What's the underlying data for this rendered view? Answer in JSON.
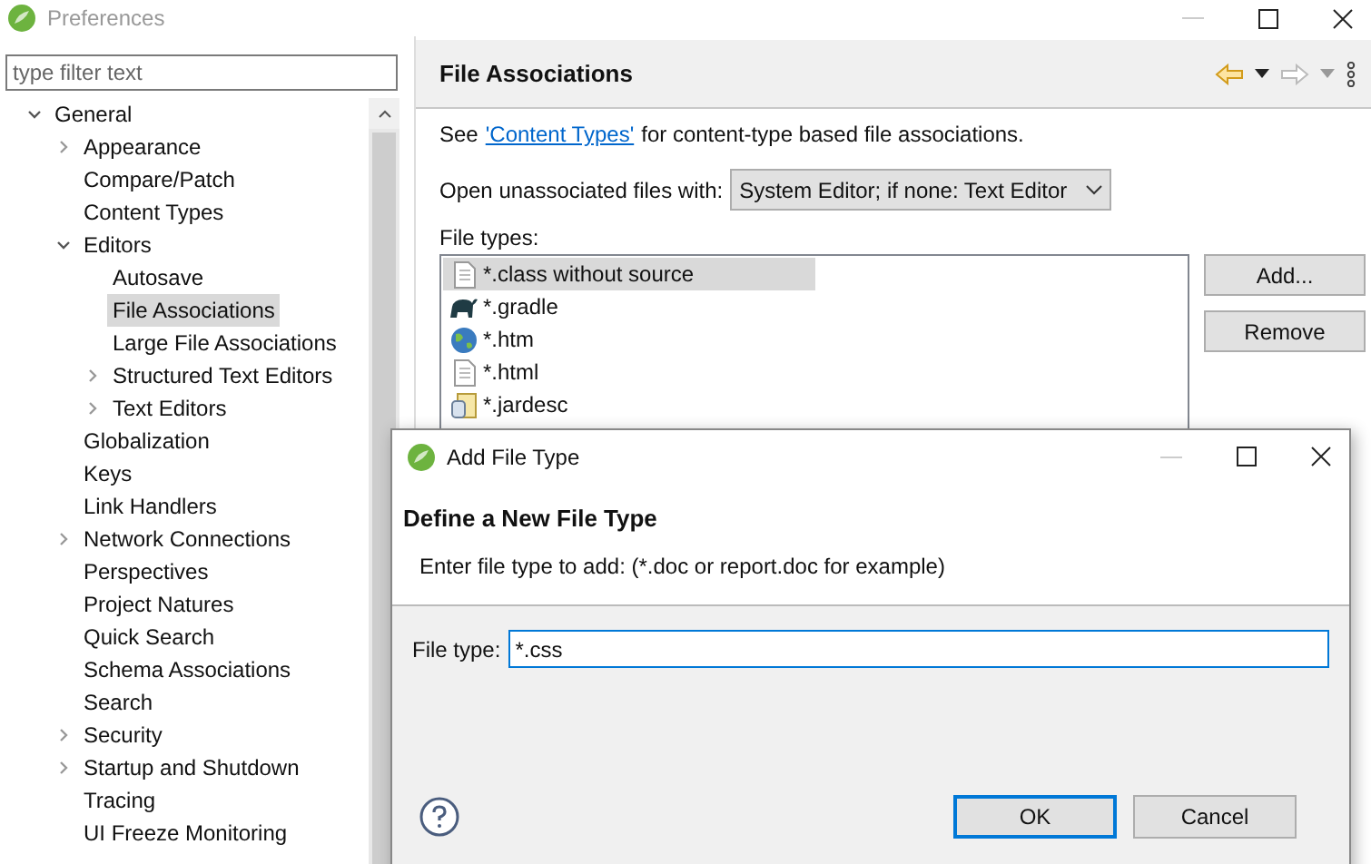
{
  "window": {
    "title": "Preferences"
  },
  "filter": {
    "placeholder": "type filter text"
  },
  "tree": [
    {
      "label": "General",
      "expanded": true,
      "selected": false,
      "children": [
        {
          "label": "Appearance",
          "expanded": false,
          "selected": false
        },
        {
          "label": "Compare/Patch",
          "selected": false
        },
        {
          "label": "Content Types",
          "selected": false
        },
        {
          "label": "Editors",
          "expanded": true,
          "selected": false,
          "children": [
            {
              "label": "Autosave",
              "selected": false
            },
            {
              "label": "File Associations",
              "selected": true
            },
            {
              "label": "Large File Associations",
              "selected": false
            },
            {
              "label": "Structured Text Editors",
              "expanded": false,
              "selected": false
            },
            {
              "label": "Text Editors",
              "expanded": false,
              "selected": false
            }
          ]
        },
        {
          "label": "Globalization",
          "selected": false
        },
        {
          "label": "Keys",
          "selected": false
        },
        {
          "label": "Link Handlers",
          "selected": false
        },
        {
          "label": "Network Connections",
          "expanded": false,
          "selected": false
        },
        {
          "label": "Perspectives",
          "selected": false
        },
        {
          "label": "Project Natures",
          "selected": false
        },
        {
          "label": "Quick Search",
          "selected": false
        },
        {
          "label": "Schema Associations",
          "selected": false
        },
        {
          "label": "Search",
          "selected": false
        },
        {
          "label": "Security",
          "expanded": false,
          "selected": false
        },
        {
          "label": "Startup and Shutdown",
          "expanded": false,
          "selected": false
        },
        {
          "label": "Tracing",
          "selected": false
        },
        {
          "label": "UI Freeze Monitoring",
          "selected": false
        }
      ]
    }
  ],
  "page": {
    "title": "File Associations",
    "intro_before": "See",
    "link": "'Content Types'",
    "intro_after": "for content-type based file associations.",
    "open_label": "Open unassociated files with:",
    "open_value": "System Editor; if none: Text Editor",
    "file_types_label": "File types:",
    "file_types": [
      {
        "label": "*.class without source",
        "kind": "file",
        "selected": true
      },
      {
        "label": "*.gradle",
        "kind": "elephant",
        "selected": false
      },
      {
        "label": "*.htm",
        "kind": "globe",
        "selected": false
      },
      {
        "label": "*.html",
        "kind": "file",
        "selected": false
      },
      {
        "label": "*.jardesc",
        "kind": "jar",
        "selected": false
      }
    ],
    "buttons": [
      "Add...",
      "Remove"
    ]
  },
  "dialog": {
    "title": "Add File Type",
    "heading": "Define a New File Type",
    "message": "Enter file type to add: (*.doc or report.doc for example)",
    "field_label": "File type:",
    "field_value": "*.css",
    "buttons": [
      {
        "label": "OK",
        "selected": true
      },
      {
        "label": "Cancel",
        "selected": false
      }
    ]
  }
}
